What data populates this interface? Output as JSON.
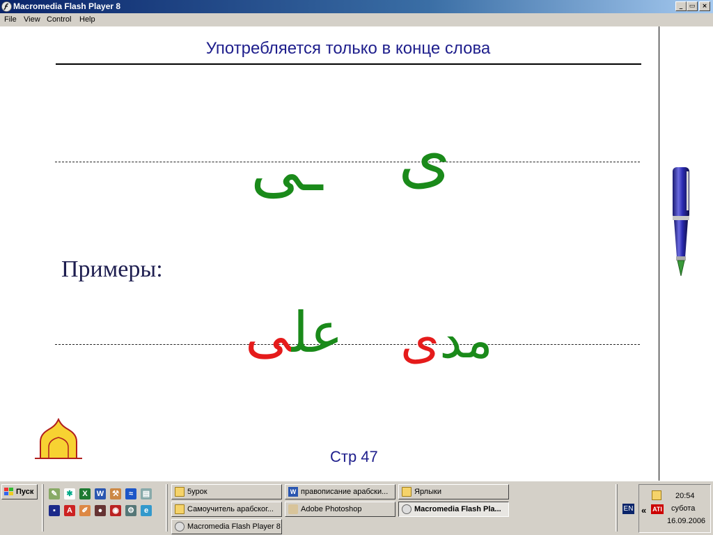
{
  "window": {
    "title": "Macromedia Flash Player 8",
    "controls": {
      "minimize": "_",
      "maximize": "▭",
      "close": "×"
    }
  },
  "menu": {
    "items": [
      "File",
      "View",
      "Control",
      "Help"
    ]
  },
  "slide": {
    "title": "Употребляется только в конце слова",
    "letter_final": "ـى",
    "letter_isolated": "ى",
    "examples_label": "Примеры:",
    "examples": [
      {
        "parts": [
          {
            "text": "عل",
            "color": "#1a8a1a"
          },
          {
            "text": "ى",
            "color": "#e51b1b"
          }
        ]
      },
      {
        "parts": [
          {
            "text": "مد",
            "color": "#1a8a1a"
          },
          {
            "text": "ى",
            "color": "#e51b1b"
          }
        ]
      }
    ],
    "page_label": "Стр 47"
  },
  "colors": {
    "title_blue": "#1e1e8c",
    "letter_green": "#1a8a1a",
    "highlight_red": "#e51b1b",
    "home_yellow": "#f7d232"
  },
  "taskbar": {
    "start_label": "Пуск",
    "tasks": [
      {
        "label": "5урок",
        "icon": "folder-icon"
      },
      {
        "label": "правописание арабски...",
        "icon": "word-icon"
      },
      {
        "label": "Ярлыки",
        "icon": "folder-icon"
      },
      {
        "label": "Самоучитель арабског...",
        "icon": "folder-icon"
      },
      {
        "label": "Adobe Photoshop",
        "icon": "photoshop-icon"
      },
      {
        "label": "Macromedia Flash Pla...",
        "icon": "flash-icon",
        "active": true
      },
      {
        "label": "Macromedia Flash Player 8",
        "icon": "flash-icon"
      }
    ],
    "language": "EN",
    "tray_chevron": "«",
    "clock_time": "20:54",
    "clock_day": "субота",
    "clock_date": "16.09.2006"
  }
}
